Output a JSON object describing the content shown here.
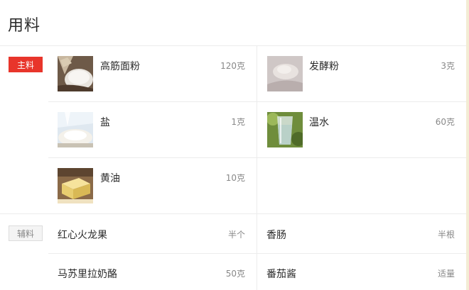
{
  "title": "用料",
  "main_tag": "主料",
  "aux_tag": "辅料",
  "main_items": [
    {
      "name": "高筋面粉",
      "amount": "120克",
      "icon": "flour-bag-icon"
    },
    {
      "name": "发酵粉",
      "amount": "3克",
      "icon": "yeast-powder-icon"
    },
    {
      "name": "盐",
      "amount": "1克",
      "icon": "salt-icon"
    },
    {
      "name": "温水",
      "amount": "60克",
      "icon": "water-glass-icon"
    },
    {
      "name": "黄油",
      "amount": "10克",
      "icon": "butter-icon"
    }
  ],
  "aux_items": [
    {
      "name": "红心火龙果",
      "amount": "半个"
    },
    {
      "name": "香肠",
      "amount": "半根"
    },
    {
      "name": "马苏里拉奶酪",
      "amount": "50克"
    },
    {
      "name": "番茄酱",
      "amount": "适量"
    }
  ]
}
